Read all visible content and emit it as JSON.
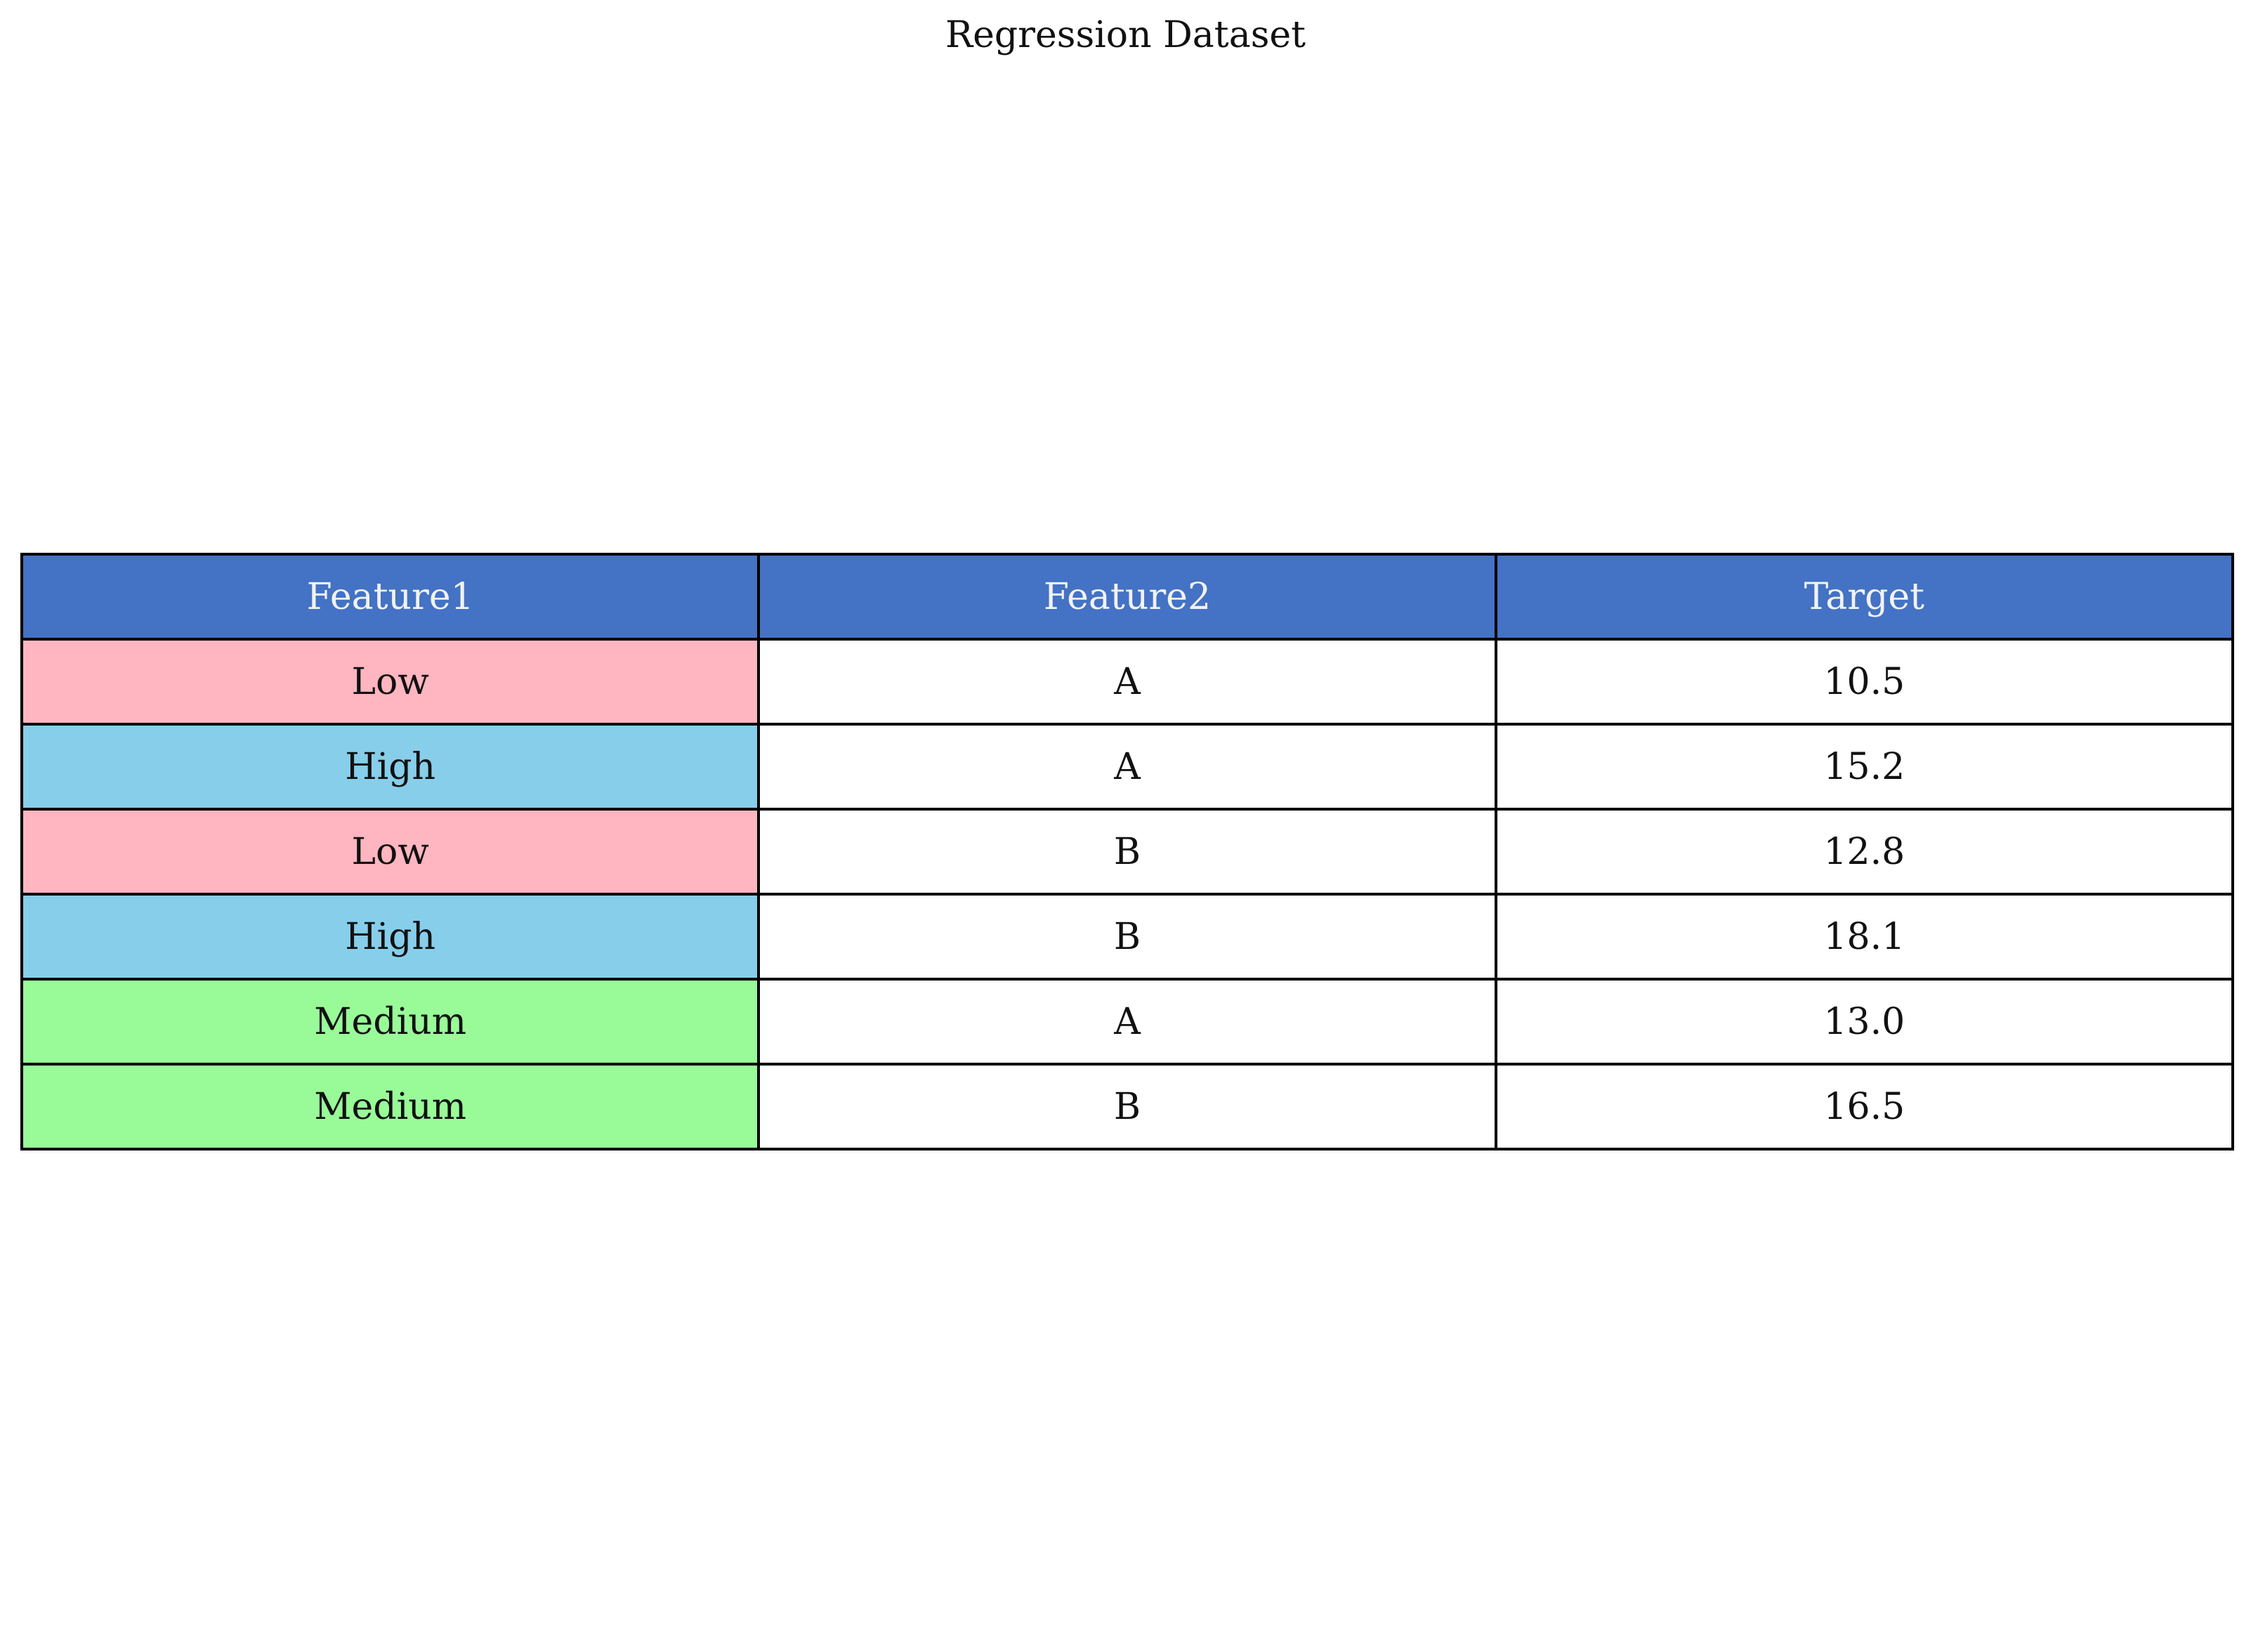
{
  "chart_data": {
    "type": "table",
    "title": "Regression Dataset",
    "columns": [
      "Feature1",
      "Feature2",
      "Target"
    ],
    "rows": [
      [
        "Low",
        "A",
        "10.5"
      ],
      [
        "High",
        "A",
        "15.2"
      ],
      [
        "Low",
        "B",
        "12.8"
      ],
      [
        "High",
        "B",
        "18.1"
      ],
      [
        "Medium",
        "A",
        "13.0"
      ],
      [
        "Medium",
        "B",
        "16.5"
      ]
    ],
    "header_color": "#4472C4",
    "feature1_colors": {
      "Low": "#FFB6C1",
      "High": "#87CEEB",
      "Medium": "#98FB98"
    }
  }
}
